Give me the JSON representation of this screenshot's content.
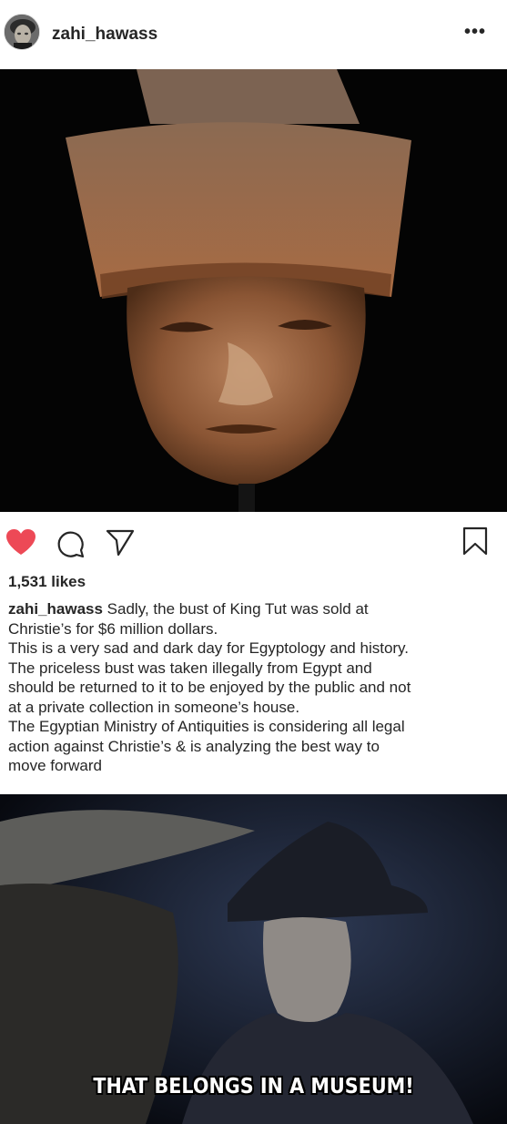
{
  "post": {
    "username": "zahi_hawass",
    "more_label": "•••",
    "likes": "1,531 likes",
    "liked": true,
    "caption_user": "zahi_hawass",
    "caption_lines": [
      " Sadly, the bust of King Tut was sold at",
      "Christie’s for $6 million dollars.",
      "This is a very sad and dark day for Egyptology and history.",
      "The priceless bust was taken illegally from Egypt and",
      "should be returned to it to be enjoyed by the public and not",
      "at a private collection in someone’s house.",
      "The Egyptian Ministry of Antiquities is considering all legal",
      "action against Christie’s & is analyzing the best way to",
      "move forward"
    ]
  },
  "icons": {
    "like": "heart-icon",
    "comment": "comment-icon",
    "share": "share-icon",
    "save": "bookmark-icon",
    "like_color": "#ed4956"
  },
  "meme": {
    "caption": "THAT BELONGS IN A MUSEUM!"
  }
}
